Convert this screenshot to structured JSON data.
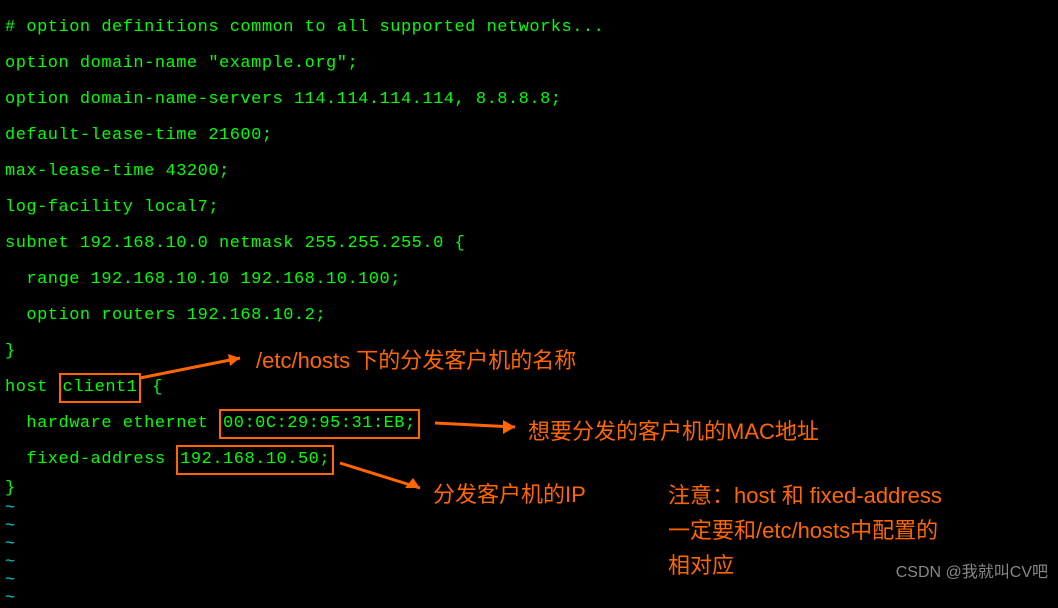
{
  "config": {
    "comment": "# option definitions common to all supported networks...",
    "optionDomainName": "option domain-name \"example.org\";",
    "optionDomainServers": "option domain-name-servers 114.114.114.114, 8.8.8.8;",
    "defaultLeaseTime": "default-lease-time 21600;",
    "maxLeaseTime": "max-lease-time 43200;",
    "logFacility": "log-facility local7;",
    "subnetLine": "subnet 192.168.10.0 netmask 255.255.255.0 {",
    "rangeLine": "  range 192.168.10.10 192.168.10.100;",
    "optionRoutersLine": "  option routers 192.168.10.2;",
    "closeBrace1": "}",
    "hostLinePrefix": "host ",
    "hostName": "client1",
    "hostLineSuffix": " {",
    "hwEthernetPrefix": "  hardware ethernet ",
    "macAddress": "00:0C:29:95:31:EB;",
    "fixedAddrPrefix": "  fixed-address ",
    "fixedIp": "192.168.10.50;",
    "closeBrace2": "}",
    "tilde": "~"
  },
  "annotations": {
    "a1": "/etc/hosts 下的分发客户机的名称",
    "a2": "想要分发的客户机的MAC地址",
    "a3": "分发客户机的IP",
    "a4line1": "注意：host 和 fixed-address",
    "a4line2": "一定要和/etc/hosts中配置的",
    "a4line3": "相对应"
  },
  "watermark": "CSDN @我就叫CV吧"
}
